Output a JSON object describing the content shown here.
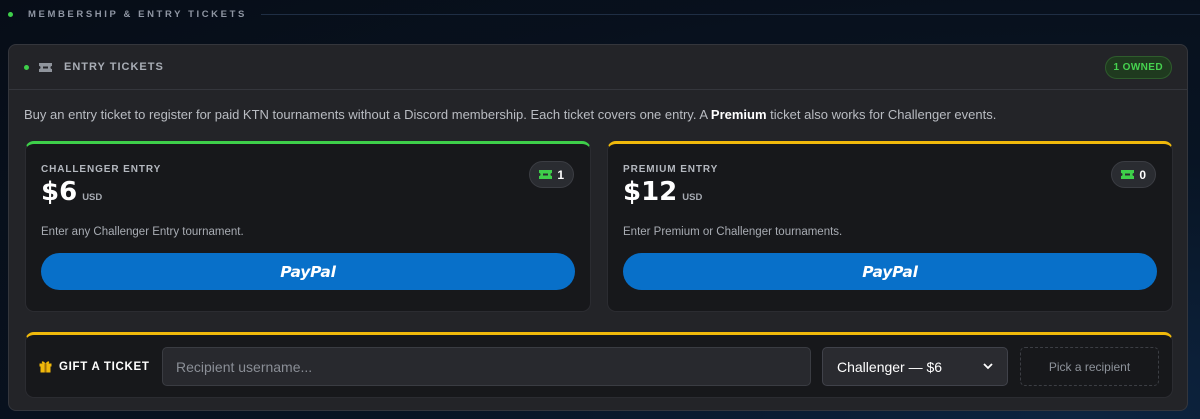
{
  "section": {
    "title": "MEMBERSHIP & ENTRY TICKETS"
  },
  "panel": {
    "title": "ENTRY TICKETS",
    "owned_badge": "1 OWNED",
    "description_start": "Buy an entry ticket to register for paid KTN tournaments without a Discord membership. Each ticket covers one entry. A ",
    "description_bold": "Premium",
    "description_end": " ticket also works for Challenger events."
  },
  "tickets": [
    {
      "label": "CHALLENGER ENTRY",
      "price": "$6",
      "currency": "USD",
      "count": "1",
      "subtitle": "Enter any Challenger Entry tournament.",
      "button_label": "PayPal"
    },
    {
      "label": "PREMIUM ENTRY",
      "price": "$12",
      "currency": "USD",
      "count": "0",
      "subtitle": "Enter Premium or Challenger tournaments.",
      "button_label": "PayPal"
    }
  ],
  "gift": {
    "label": "GIFT A TICKET",
    "recipient_placeholder": "Recipient username...",
    "recipient_value": "",
    "selected_option": "Challenger — $6",
    "pick_button": "Pick a recipient"
  },
  "icons": {
    "ticket": "ticket-icon",
    "gift": "gift-icon",
    "dropdown": "chevron-down-icon"
  },
  "colors": {
    "accent_green": "#3ecf4a",
    "accent_gold": "#f0b90b",
    "paypal_blue": "#0870c9"
  }
}
